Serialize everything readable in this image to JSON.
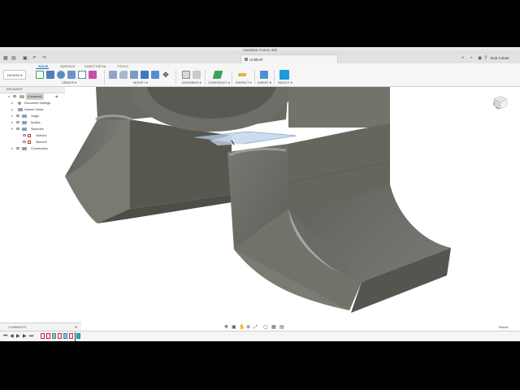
{
  "window": {
    "title": "Autodesk Fusion 360"
  },
  "tabbar": {
    "document_tab": "Untitled*",
    "user_name": "Rob Cohee"
  },
  "ribbon": {
    "workspace_button": "DESIGN ▾",
    "tabs": [
      "SOLID",
      "SURFACE",
      "SHEET METAL",
      "TOOLS"
    ],
    "groups": {
      "create": "CREATE ▾",
      "modify": "MODIFY ▾",
      "assemble": "ASSEMBLE ▾",
      "construct": "CONSTRUCT ▾",
      "inspect": "INSPECT ▾",
      "insert": "INSERT ▾",
      "select": "SELECT ▾"
    },
    "colors": {
      "active_tab": "#1a6fc0",
      "select_icon": "#1a9be0",
      "construct_icon": "#3aa35a"
    }
  },
  "browser": {
    "header": "BROWSER",
    "root": "(Unsaved)",
    "items": [
      {
        "label": "Document Settings"
      },
      {
        "label": "Named Views"
      },
      {
        "label": "Origin"
      },
      {
        "label": "Bodies"
      },
      {
        "label": "Sketches"
      },
      {
        "label": "Sketch1"
      },
      {
        "label": "Sketch2"
      },
      {
        "label": "Construction"
      }
    ]
  },
  "comments": {
    "label": "COMMENTS"
  },
  "status": {
    "selection": "Plane1"
  },
  "viewport": {
    "body_color": "#6f6f68",
    "plane_color": "#b8d0e8"
  },
  "icons": {
    "timeline": [
      "skip-start-icon",
      "step-back-icon",
      "play-icon",
      "step-forward-icon",
      "skip-end-icon"
    ],
    "nav": [
      "orbit-icon",
      "pan-icon",
      "zoom-icon",
      "fit-icon",
      "display-icon",
      "grid-icon",
      "viewports-icon"
    ]
  }
}
